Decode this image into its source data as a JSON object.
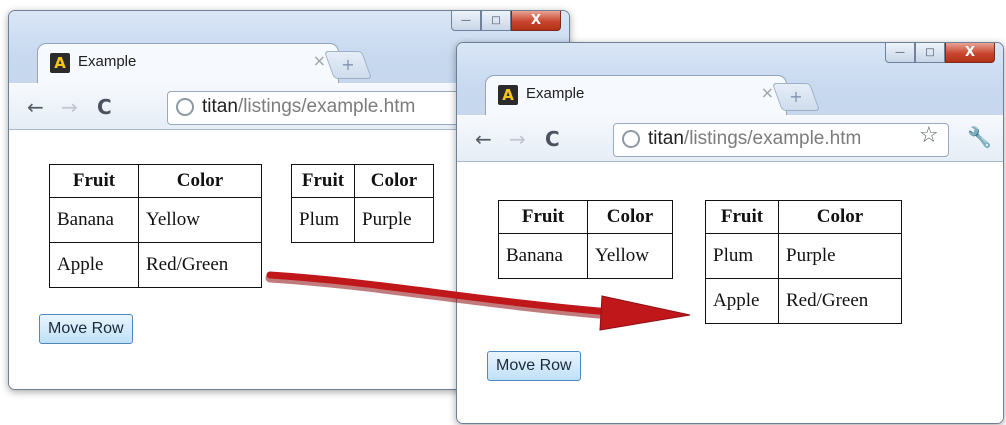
{
  "browser": {
    "tab_title": "Example",
    "tab_close": "×",
    "new_tab": "+",
    "url_host": "titan",
    "url_path": "/listings/example.htm",
    "nav": {
      "back": "←",
      "forward": "→",
      "reload": "C"
    },
    "controls": {
      "minimize": "—",
      "maximize": "□",
      "close": "X"
    },
    "star": "☆",
    "wrench": "🔧"
  },
  "before": {
    "table1": {
      "headers": [
        "Fruit",
        "Color"
      ],
      "rows": [
        [
          "Banana",
          "Yellow"
        ],
        [
          "Apple",
          "Red/Green"
        ]
      ]
    },
    "table2": {
      "headers": [
        "Fruit",
        "Color"
      ],
      "rows": [
        [
          "Plum",
          "Purple"
        ]
      ]
    },
    "button": "Move Row"
  },
  "after": {
    "table1": {
      "headers": [
        "Fruit",
        "Color"
      ],
      "rows": [
        [
          "Banana",
          "Yellow"
        ]
      ]
    },
    "table2": {
      "headers": [
        "Fruit",
        "Color"
      ],
      "rows": [
        [
          "Plum",
          "Purple"
        ],
        [
          "Apple",
          "Red/Green"
        ]
      ]
    },
    "button": "Move Row"
  },
  "colors": {
    "arrow": "#c0171b",
    "window_frame": "#c7d8ef",
    "button_fill": "#d3ebfb"
  }
}
